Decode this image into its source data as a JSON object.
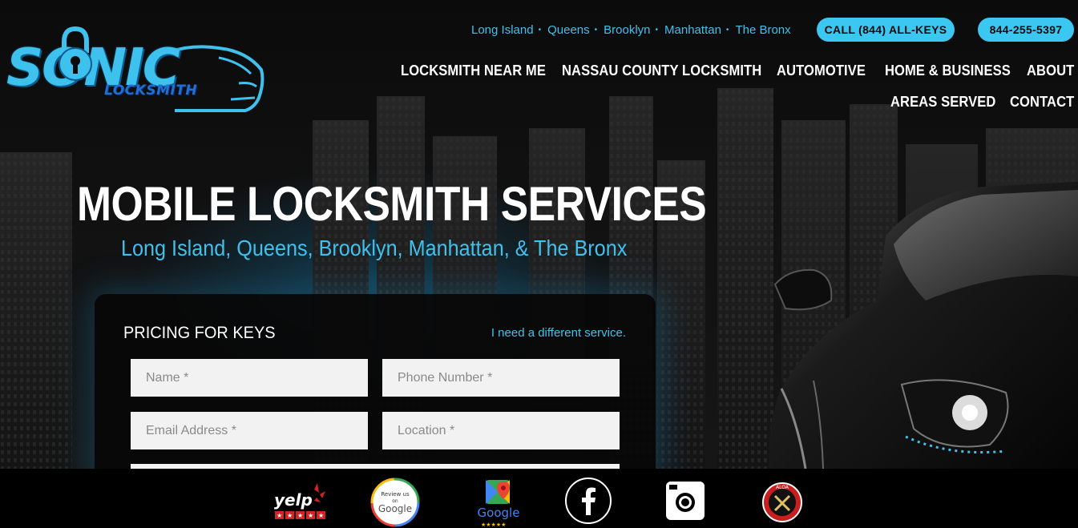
{
  "brand": {
    "logo_main": "SONIC",
    "logo_sub": "LOCKSMITH",
    "accent_color": "#3fc1ee"
  },
  "header": {
    "service_areas": [
      "Long Island",
      "Queens",
      "Brooklyn",
      "Manhattan",
      "The Bronx"
    ],
    "separator": "•",
    "call_button": "CALL (844) ALL-KEYS",
    "phone_button": "844-255-5397"
  },
  "nav": {
    "items": [
      "LOCKSMITH NEAR ME",
      "NASSAU COUNTY LOCKSMITH",
      "AUTOMOTIVE",
      "HOME & BUSINESS",
      "ABOUT",
      "AREAS SERVED",
      "CONTACT"
    ]
  },
  "hero": {
    "headline": "MOBILE LOCKSMITH SERVICES",
    "subhead": "Long Island, Queens, Brooklyn, Manhattan, & The Bronx"
  },
  "form": {
    "title": "PRICING FOR KEYS",
    "alt_link": "I need a different service.",
    "name_placeholder": "Name *",
    "phone_placeholder": "Phone Number *",
    "email_placeholder": "Email Address *",
    "location_placeholder": "Location *"
  },
  "footer": {
    "badges": [
      "yelp-icon",
      "google-review-icon",
      "google-maps-icon",
      "facebook-icon",
      "instagram-icon",
      "aloa-seal-icon"
    ],
    "yelp_label": "yelp",
    "review_line1": "Review us",
    "review_line2": "on",
    "review_google": "Google",
    "maps_google": "Google",
    "aloa_label": "ALOA"
  }
}
